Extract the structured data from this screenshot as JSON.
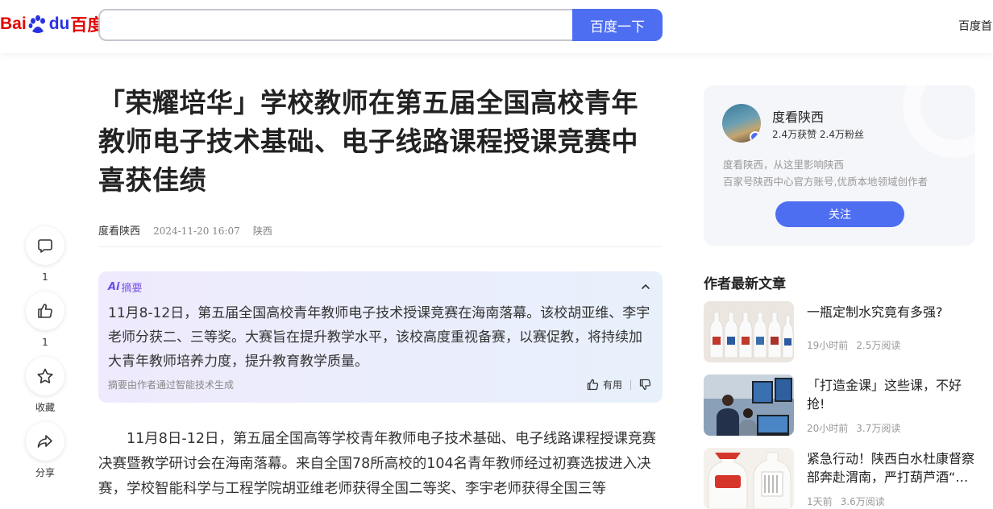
{
  "header": {
    "logo": {
      "bai": "Bai",
      "du": "du",
      "cn": "百度"
    },
    "search": {
      "value": "",
      "placeholder": ""
    },
    "search_button": "百度一下",
    "home_link": "百度首页"
  },
  "actions": [
    {
      "icon": "comment-icon",
      "label": "1"
    },
    {
      "icon": "thumbs-up-icon",
      "label": "1"
    },
    {
      "icon": "star-icon",
      "label": "收藏"
    },
    {
      "icon": "share-icon",
      "label": "分享"
    }
  ],
  "article": {
    "title": "「荣耀培华」学校教师在第五届全国高校青年教师电子技术基础、电子线路课程授课竞赛中喜获佳绩",
    "author": "度看陕西",
    "time": "2024-11-20 16:07",
    "location": "陕西",
    "body": "11月8日-12日，第五届全国高等学校青年教师电子技术基础、电子线路课程授课竞赛决赛暨教学研讨会在海南落幕。来自全国78所高校的104名青年教师经过初赛选拔进入决赛，学校智能科学与工程学院胡亚维老师获得全国二等奖、李宇老师获得全国三等"
  },
  "summary": {
    "ai_mark": "Ai",
    "label": "摘要",
    "text": "11月8-12日，第五届全国高校青年教师电子技术授课竞赛在海南落幕。该校胡亚维、李宇老师分获二、三等奖。大赛旨在提升教学水平，该校高度重视备赛，以赛促教，将持续加大青年教师培养力度，提升教育教学质量。",
    "footer": "摘要由作者通过智能技术生成",
    "useful": "有用"
  },
  "author_card": {
    "name": "度看陕西",
    "stats": "2.4万获赞 2.4万粉丝",
    "desc_line1": "度看陕西，从这里影响陕西",
    "desc_line2": "百家号陕西中心官方账号,优质本地领域创作者",
    "follow": "关注"
  },
  "recent": {
    "title": "作者最新文章",
    "items": [
      {
        "title": "一瓶定制水究竟有多强?",
        "time": "19小时前",
        "reads": "2.5万阅读"
      },
      {
        "title": "「打造金课」这些课，不好抢!",
        "time": "20小时前",
        "reads": "3.7万阅读"
      },
      {
        "title": "紧急行动！陕西白水杜康督察部奔赴渭南，严打葫芦酒“…",
        "time": "1天前",
        "reads": "3.6万阅读"
      }
    ]
  },
  "colors": {
    "accent": "#4e6ef2",
    "logo_red": "#e10602",
    "logo_blue": "#2932e1",
    "ai_purple": "#6a4de8"
  }
}
